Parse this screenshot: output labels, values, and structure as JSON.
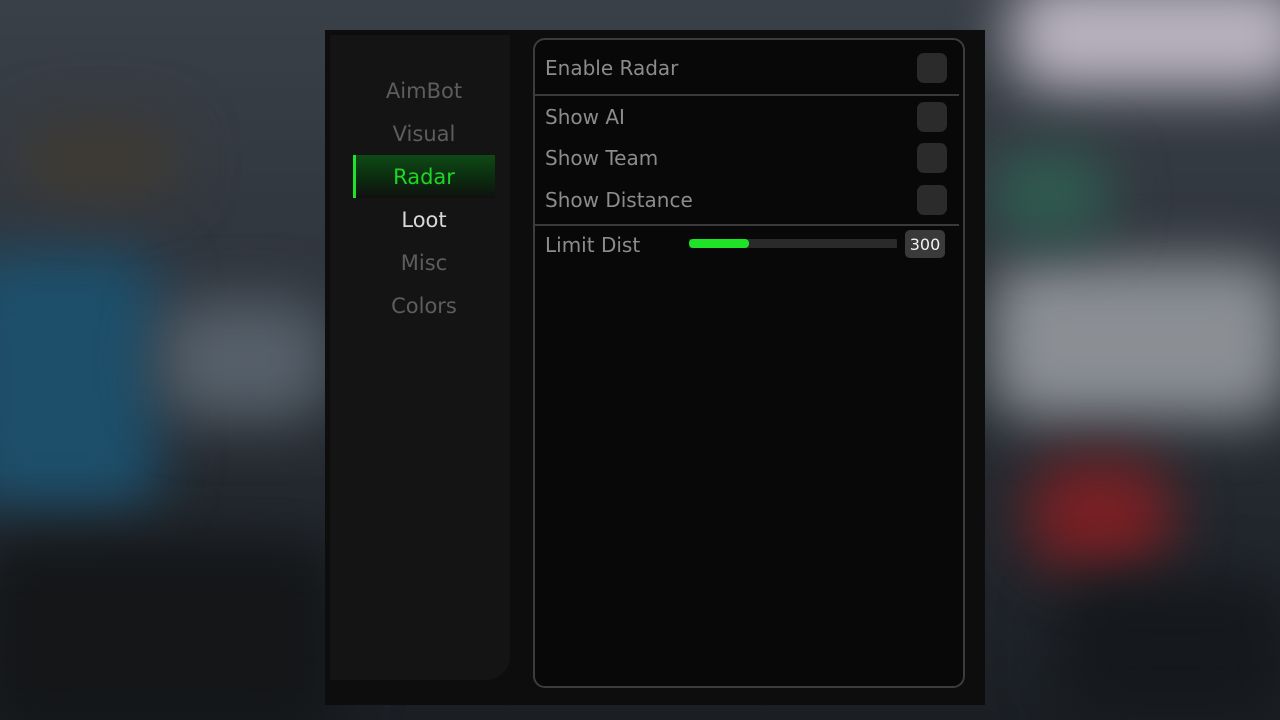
{
  "sidebar": {
    "items": [
      {
        "label": "AimBot",
        "state": "normal"
      },
      {
        "label": "Visual",
        "state": "normal"
      },
      {
        "label": "Radar",
        "state": "active"
      },
      {
        "label": "Loot",
        "state": "hover"
      },
      {
        "label": "Misc",
        "state": "normal"
      },
      {
        "label": "Colors",
        "state": "normal"
      }
    ]
  },
  "radar": {
    "enable_label": "Enable Radar",
    "enable_on": false,
    "options": [
      {
        "label": "Show AI",
        "on": false
      },
      {
        "label": "Show Team",
        "on": false
      },
      {
        "label": "Show Distance",
        "on": false
      }
    ],
    "limit_dist": {
      "label": "Limit Dist",
      "value_text": "300",
      "fill_fraction": 0.29
    }
  },
  "colors": {
    "accent": "#1fe326",
    "panel_border": "#3c3c3c",
    "toggle_off": "#2b2b2b"
  }
}
